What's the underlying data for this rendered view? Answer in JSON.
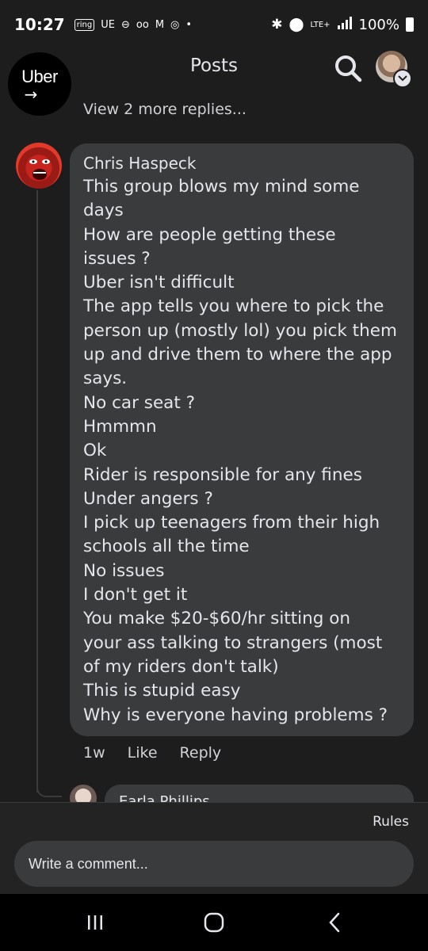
{
  "status_bar": {
    "time": "10:27",
    "ring_badge": "ring",
    "ue_badge": "UE",
    "network": "LTE+",
    "battery": "100%"
  },
  "header": {
    "logo_text": "Uber",
    "title": "Posts"
  },
  "thread": {
    "view_more": "View 2 more replies..."
  },
  "comment": {
    "author": "Chris Haspeck",
    "lines": [
      "This group blows my mind some",
      "days",
      "How are people getting these",
      "issues ?",
      "Uber isn't difficult",
      "The app tells you where to pick the",
      "person up (mostly lol) you pick them",
      "up and drive them to where the app",
      "says.",
      "No car seat ?",
      "Hmmmn",
      "Ok",
      "Rider is responsible for any fines",
      "Under angers ?",
      "I pick up teenagers from their high",
      "schools all the time",
      "No issues",
      "I don't get it",
      "You make $20-$60/hr sitting on",
      "your ass talking to strangers (most",
      "of my riders don't talk)",
      "This is stupid easy",
      "Why is everyone having problems ?"
    ],
    "time_ago": "1w",
    "like_label": "Like",
    "reply_label": "Reply"
  },
  "reply_preview": {
    "author": "Earla Phillips"
  },
  "composer": {
    "rules_label": "Rules",
    "placeholder": "Write a comment..."
  },
  "colors": {
    "background": "#1d1d1e",
    "bubble": "#3a3b3c",
    "text": "#e4e6eb"
  }
}
